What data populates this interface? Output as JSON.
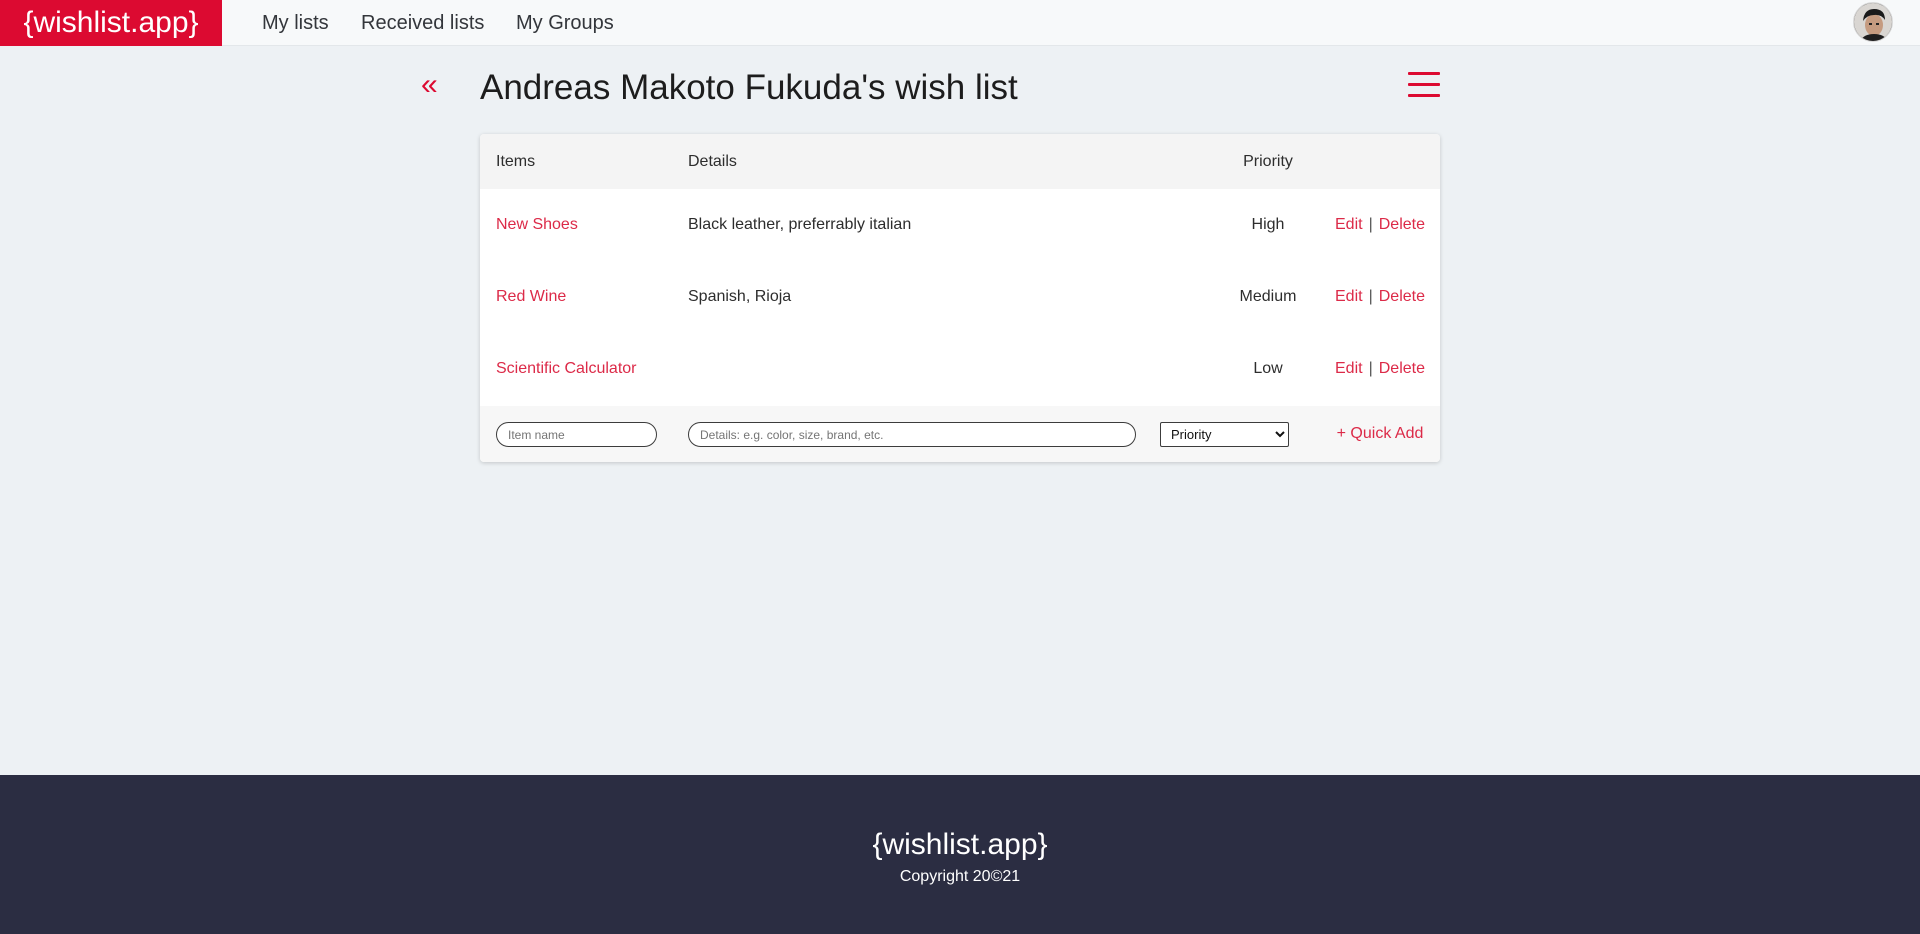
{
  "brand": "{wishlist.app}",
  "nav": {
    "my_lists": "My lists",
    "received_lists": "Received lists",
    "my_groups": "My Groups"
  },
  "header": {
    "back_icon": "«",
    "title": "Andreas Makoto Fukuda's wish list",
    "menu_icon": "hamburger-menu-icon"
  },
  "table": {
    "columns": [
      "Items",
      "Details",
      "Priority"
    ],
    "rows": [
      {
        "name": "New Shoes",
        "details": "Black leather, preferrably italian",
        "priority": "High",
        "edit": "Edit",
        "delete": "Delete"
      },
      {
        "name": "Red Wine",
        "details": "Spanish, Rioja",
        "priority": "Medium",
        "edit": "Edit",
        "delete": "Delete"
      },
      {
        "name": "Scientific Calculator",
        "details": "",
        "priority": "Low",
        "edit": "Edit",
        "delete": "Delete"
      }
    ],
    "separator": "|"
  },
  "quick_add": {
    "name_placeholder": "Item name",
    "details_placeholder": "Details: e.g. color, size, brand, etc.",
    "priority_selected": "Priority",
    "button_label": "+ Quick Add"
  },
  "footer": {
    "brand": "{wishlist.app}",
    "copyright": "Copyright 20©21"
  },
  "colors": {
    "accent": "#dc0a31",
    "link": "#dc2a48",
    "footer_bg": "#2b2d42",
    "page_bg": "#edf1f4"
  }
}
